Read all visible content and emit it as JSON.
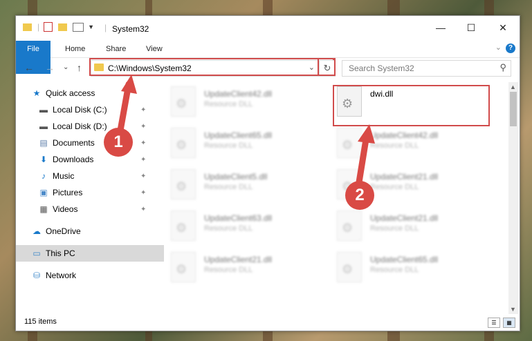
{
  "window": {
    "title": "System32",
    "min_glyph": "—",
    "max_glyph": "☐",
    "close_glyph": "✕"
  },
  "ribbon": {
    "tabs": [
      "File",
      "Home",
      "Share",
      "View"
    ],
    "collapse_glyph": "⌄",
    "help_glyph": "?"
  },
  "nav": {
    "back_glyph": "←",
    "forward_glyph": "→",
    "recent_glyph": "⌄",
    "up_glyph": "↑"
  },
  "address": {
    "path": "C:\\Windows\\System32",
    "dropdown_glyph": "⌄",
    "refresh_glyph": "↻"
  },
  "search": {
    "placeholder": "Search System32",
    "icon_glyph": "⚲"
  },
  "sidebar": {
    "pin_glyph": "✦",
    "items": [
      {
        "label": "Quick access",
        "icon": "star-icon",
        "glyph": "★",
        "color": "#1979ca",
        "pinned": false
      },
      {
        "label": "Local Disk (C:)",
        "icon": "drive-icon",
        "glyph": "▬",
        "color": "#555555",
        "pinned": true
      },
      {
        "label": "Local Disk (D:)",
        "icon": "drive-icon",
        "glyph": "▬",
        "color": "#555555",
        "pinned": true
      },
      {
        "label": "Documents",
        "icon": "documents-icon",
        "glyph": "▤",
        "color": "#5a7ca8",
        "pinned": true
      },
      {
        "label": "Downloads",
        "icon": "download-icon",
        "glyph": "⬇",
        "color": "#1979ca",
        "pinned": true
      },
      {
        "label": "Music",
        "icon": "music-icon",
        "glyph": "♪",
        "color": "#1979ca",
        "pinned": true
      },
      {
        "label": "Pictures",
        "icon": "pictures-icon",
        "glyph": "▣",
        "color": "#4b8ac9",
        "pinned": true
      },
      {
        "label": "Videos",
        "icon": "videos-icon",
        "glyph": "▦",
        "color": "#555555",
        "pinned": true
      },
      {
        "label": "OneDrive",
        "icon": "cloud-icon",
        "glyph": "☁",
        "color": "#1979ca",
        "pinned": false
      },
      {
        "label": "This PC",
        "icon": "computer-icon",
        "glyph": "▭",
        "color": "#3a86c8",
        "pinned": false
      },
      {
        "label": "Network",
        "icon": "network-icon",
        "glyph": "⛁",
        "color": "#3a86c8",
        "pinned": false
      }
    ]
  },
  "files": {
    "gear_glyph": "⚙",
    "left_column": [
      {
        "name": "UpdateClient42.dll",
        "type": "Resource DLL"
      },
      {
        "name": "UpdateClient65.dll",
        "type": "Resource DLL"
      },
      {
        "name": "UpdateClient5.dll",
        "type": "Resource DLL"
      },
      {
        "name": "UpdateClient63.dll",
        "type": "Resource DLL"
      },
      {
        "name": "UpdateClient21.dll",
        "type": "Resource DLL"
      }
    ],
    "right_column": [
      {
        "name": "dwi.dll",
        "type": ""
      },
      {
        "name": "UpdateClient42.dll",
        "type": "Resource DLL"
      },
      {
        "name": "UpdateClient21.dll",
        "type": "Resource DLL"
      },
      {
        "name": "UpdateClient21.dll",
        "type": "Resource DLL"
      },
      {
        "name": "UpdateClient65.dll",
        "type": "Resource DLL"
      }
    ]
  },
  "scrollbar": {
    "up_glyph": "▲",
    "down_glyph": "▼"
  },
  "status": {
    "items_count": "115 items",
    "details_glyph": "☰",
    "tiles_glyph": "▦"
  },
  "callouts": [
    "1",
    "2"
  ],
  "colors": {
    "accent": "#1979ca",
    "highlight": "#d14b4b",
    "callout": "#d94a45"
  }
}
